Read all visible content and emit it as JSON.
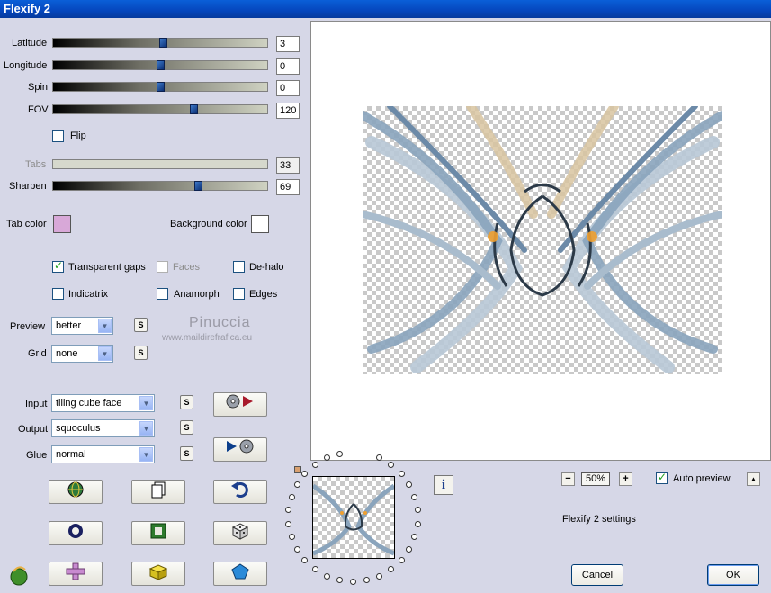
{
  "window": {
    "title": "Flexify 2"
  },
  "sliders": {
    "latitude": {
      "label": "Latitude",
      "value": "3"
    },
    "longitude": {
      "label": "Longitude",
      "value": "0"
    },
    "spin": {
      "label": "Spin",
      "value": "0"
    },
    "fov": {
      "label": "FOV",
      "value": "120"
    },
    "tabs": {
      "label": "Tabs",
      "value": "33"
    },
    "sharpen": {
      "label": "Sharpen",
      "value": "69"
    }
  },
  "flip": {
    "label": "Flip",
    "checked": false
  },
  "colors": {
    "tab_color_label": "Tab color",
    "tab_color": "#d8a8d8",
    "background_color_label": "Background color",
    "background_color": "#ffffff"
  },
  "options": {
    "transparent_gaps": {
      "label": "Transparent gaps",
      "checked": true
    },
    "faces": {
      "label": "Faces",
      "checked": false
    },
    "de_halo": {
      "label": "De-halo",
      "checked": false
    },
    "indicatrix": {
      "label": "Indicatrix",
      "checked": false
    },
    "anamorph": {
      "label": "Anamorph",
      "checked": false
    },
    "edges": {
      "label": "Edges",
      "checked": false
    }
  },
  "dropdowns": {
    "preview": {
      "label": "Preview",
      "value": "better"
    },
    "grid": {
      "label": "Grid",
      "value": "none"
    },
    "input": {
      "label": "Input",
      "value": "tiling cube face"
    },
    "output": {
      "label": "Output",
      "value": "squoculus"
    },
    "glue": {
      "label": "Glue",
      "value": "normal"
    }
  },
  "s_button_label": "S",
  "watermark": {
    "name": "Pinuccia",
    "url": "www.maildirefrafica.eu"
  },
  "zoom": {
    "minus": "−",
    "value": "50%",
    "plus": "+"
  },
  "auto_preview": {
    "label": "Auto preview",
    "checked": true
  },
  "settings_label": "Flexify 2 settings",
  "info_label": "i",
  "collapse_label": "▲",
  "buttons": {
    "cancel": "Cancel",
    "ok": "OK"
  },
  "accent": {
    "title_bar": "#0a5fd8",
    "thumb": "#1f4fa0"
  }
}
